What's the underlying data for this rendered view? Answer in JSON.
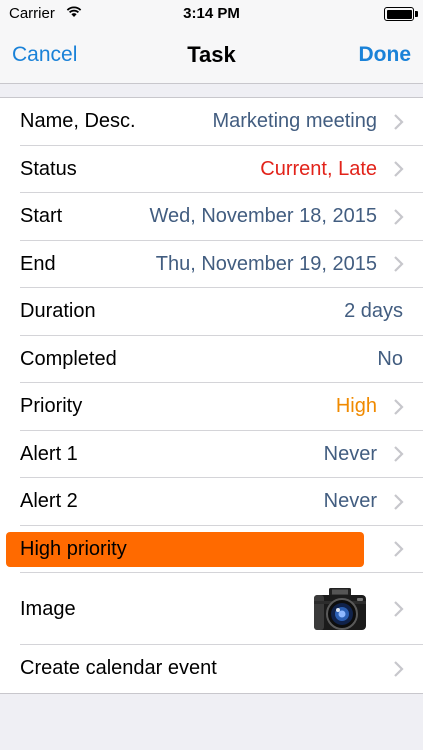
{
  "status_bar": {
    "carrier": "Carrier",
    "time": "3:14 PM"
  },
  "nav": {
    "cancel_label": "Cancel",
    "title": "Task",
    "done_label": "Done"
  },
  "rows": [
    {
      "label": "Name, Desc.",
      "value": "Marketing meeting"
    },
    {
      "label": "Status",
      "value": "Current, Late",
      "value_color": "#e2231a"
    },
    {
      "label": "Start",
      "value": "Wed, November 18, 2015"
    },
    {
      "label": "End",
      "value": "Thu, November 19, 2015"
    },
    {
      "label": "Duration",
      "value": "2 days"
    },
    {
      "label": "Completed",
      "value": "No"
    },
    {
      "label": "Priority",
      "value": "High",
      "value_color": "#f08a00"
    },
    {
      "label": "Alert 1",
      "value": "Never"
    },
    {
      "label": "Alert 2",
      "value": "Never"
    },
    {
      "label": "High priority",
      "highlight_color": "#ff6a00"
    },
    {
      "label": "Image",
      "icon": "camera-icon"
    },
    {
      "label": "Create calendar event"
    }
  ],
  "colors": {
    "accent": "#1a82d8",
    "value_text": "#425d80"
  }
}
